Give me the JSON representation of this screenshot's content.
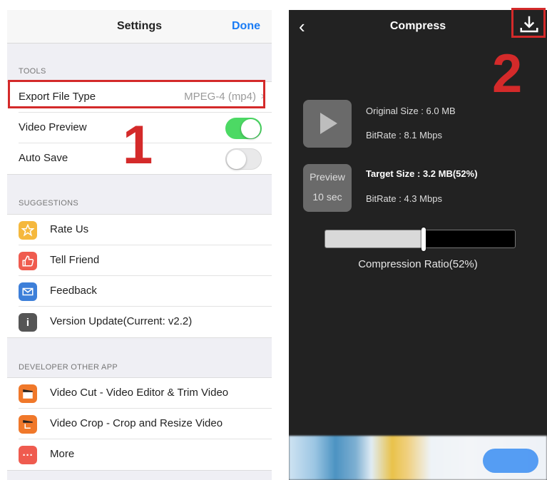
{
  "settings": {
    "title": "Settings",
    "done_label": "Done",
    "tools": {
      "header": "TOOLS",
      "export_label": "Export File Type",
      "export_value": "MPEG-4 (mp4)",
      "video_preview_label": "Video Preview",
      "video_preview_on": true,
      "auto_save_label": "Auto Save",
      "auto_save_on": false
    },
    "suggestions": {
      "header": "SUGGESTIONS",
      "items": [
        {
          "label": "Rate Us",
          "icon": "star-icon",
          "color": "#f5b83d"
        },
        {
          "label": "Tell Friend",
          "icon": "thumbs-up-icon",
          "color": "#ef5b4f"
        },
        {
          "label": "Feedback",
          "icon": "mail-icon",
          "color": "#3d7fd9"
        },
        {
          "label": "Version Update(Current: v2.2)",
          "icon": "info-icon",
          "color": "#555555"
        }
      ]
    },
    "developer": {
      "header": "DEVELOPER OTHER APP",
      "items": [
        {
          "label": "Video Cut - Video Editor & Trim Video",
          "icon": "clapper-icon",
          "color": "#f0782a"
        },
        {
          "label": "Video Crop - Crop and Resize Video",
          "icon": "clapper-crop-icon",
          "color": "#f0782a"
        },
        {
          "label": "More",
          "icon": "more-icon",
          "color": "#ef5b4f"
        }
      ]
    }
  },
  "annotations": {
    "one": "1",
    "two": "2",
    "color": "#d42a2a"
  },
  "compress": {
    "title": "Compress",
    "original_size": "Original Size : 6.0 MB",
    "original_bitrate": "BitRate : 8.1 Mbps",
    "preview_label": "Preview",
    "preview_duration": "10 sec",
    "target_size": "Target Size : 3.2 MB(52%)",
    "target_bitrate": "BitRate : 4.3 Mbps",
    "ratio_label": "Compression Ratio(52%)",
    "ratio_fraction": 0.52
  }
}
